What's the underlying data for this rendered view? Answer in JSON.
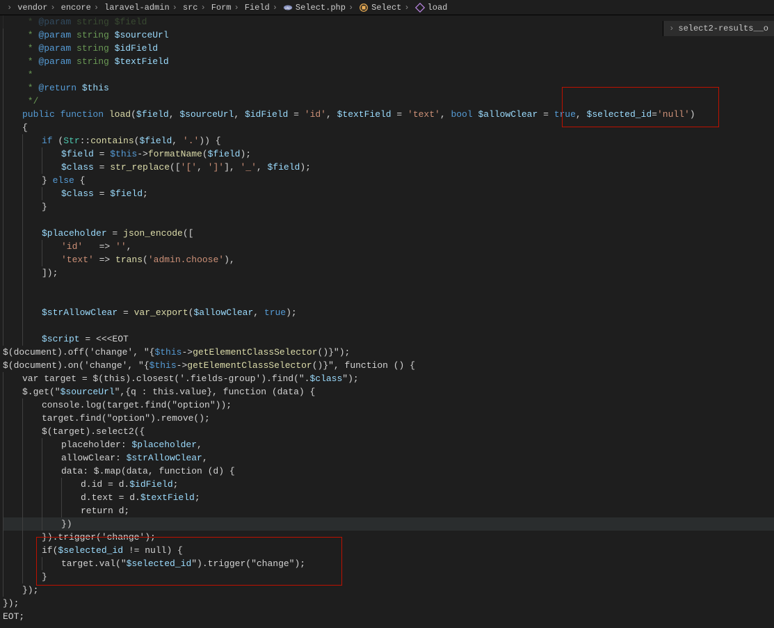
{
  "breadcrumb": {
    "items": [
      {
        "label": "vendor",
        "icon": null
      },
      {
        "label": "encore",
        "icon": null
      },
      {
        "label": "laravel-admin",
        "icon": null
      },
      {
        "label": "src",
        "icon": null
      },
      {
        "label": "Form",
        "icon": null
      },
      {
        "label": "Field",
        "icon": null
      },
      {
        "label": "Select.php",
        "icon": "php"
      },
      {
        "label": "Select",
        "icon": "class"
      },
      {
        "label": "load",
        "icon": "method"
      }
    ]
  },
  "tabs": {
    "right": {
      "label": "select2-results__o"
    }
  },
  "code_lines": [
    {
      "ind": 1,
      "tokens": [
        {
          "c": "c-comment",
          "t": " * "
        },
        {
          "c": "c-doctag",
          "t": "@param"
        },
        {
          "c": "c-comment",
          "t": " string $field"
        }
      ],
      "faded": true
    },
    {
      "ind": 1,
      "tokens": [
        {
          "c": "c-comment",
          "t": " * "
        },
        {
          "c": "c-doctag",
          "t": "@param"
        },
        {
          "c": "c-comment",
          "t": " string "
        },
        {
          "c": "c-var",
          "t": "$sourceUrl"
        }
      ]
    },
    {
      "ind": 1,
      "tokens": [
        {
          "c": "c-comment",
          "t": " * "
        },
        {
          "c": "c-doctag",
          "t": "@param"
        },
        {
          "c": "c-comment",
          "t": " string "
        },
        {
          "c": "c-var",
          "t": "$idField"
        }
      ]
    },
    {
      "ind": 1,
      "tokens": [
        {
          "c": "c-comment",
          "t": " * "
        },
        {
          "c": "c-doctag",
          "t": "@param"
        },
        {
          "c": "c-comment",
          "t": " string "
        },
        {
          "c": "c-var",
          "t": "$textField"
        }
      ]
    },
    {
      "ind": 1,
      "tokens": [
        {
          "c": "c-comment",
          "t": " *"
        }
      ]
    },
    {
      "ind": 1,
      "tokens": [
        {
          "c": "c-comment",
          "t": " * "
        },
        {
          "c": "c-doctag",
          "t": "@return"
        },
        {
          "c": "c-comment",
          "t": " "
        },
        {
          "c": "c-var",
          "t": "$this"
        }
      ]
    },
    {
      "ind": 1,
      "tokens": [
        {
          "c": "c-comment",
          "t": " */"
        }
      ]
    },
    {
      "ind": 1,
      "tokens": [
        {
          "c": "c-kw",
          "t": "public"
        },
        {
          "c": "c-op",
          "t": " "
        },
        {
          "c": "c-kw",
          "t": "function"
        },
        {
          "c": "c-op",
          "t": " "
        },
        {
          "c": "c-fn",
          "t": "load"
        },
        {
          "c": "c-punct",
          "t": "("
        },
        {
          "c": "c-var",
          "t": "$field"
        },
        {
          "c": "c-punct",
          "t": ", "
        },
        {
          "c": "c-var",
          "t": "$sourceUrl"
        },
        {
          "c": "c-punct",
          "t": ", "
        },
        {
          "c": "c-var",
          "t": "$idField"
        },
        {
          "c": "c-op",
          "t": " = "
        },
        {
          "c": "c-str",
          "t": "'id'"
        },
        {
          "c": "c-punct",
          "t": ", "
        },
        {
          "c": "c-var",
          "t": "$textField"
        },
        {
          "c": "c-op",
          "t": " = "
        },
        {
          "c": "c-str",
          "t": "'text'"
        },
        {
          "c": "c-punct",
          "t": ", "
        },
        {
          "c": "c-kw",
          "t": "bool"
        },
        {
          "c": "c-op",
          "t": " "
        },
        {
          "c": "c-var",
          "t": "$allowClear"
        },
        {
          "c": "c-op",
          "t": " = "
        },
        {
          "c": "c-const",
          "t": "true"
        },
        {
          "c": "c-punct",
          "t": ", "
        },
        {
          "c": "c-var",
          "t": "$selected_id"
        },
        {
          "c": "c-op",
          "t": "="
        },
        {
          "c": "c-str",
          "t": "'null'"
        },
        {
          "c": "c-punct",
          "t": ")"
        }
      ]
    },
    {
      "ind": 1,
      "tokens": [
        {
          "c": "c-punct",
          "t": "{"
        }
      ]
    },
    {
      "ind": 2,
      "tokens": [
        {
          "c": "c-kw",
          "t": "if"
        },
        {
          "c": "c-punct",
          "t": " ("
        },
        {
          "c": "c-type",
          "t": "Str"
        },
        {
          "c": "c-punct",
          "t": "::"
        },
        {
          "c": "c-fn",
          "t": "contains"
        },
        {
          "c": "c-punct",
          "t": "("
        },
        {
          "c": "c-var",
          "t": "$field"
        },
        {
          "c": "c-punct",
          "t": ", "
        },
        {
          "c": "c-str",
          "t": "'.'"
        },
        {
          "c": "c-punct",
          "t": ")) {"
        }
      ]
    },
    {
      "ind": 3,
      "tokens": [
        {
          "c": "c-var",
          "t": "$field"
        },
        {
          "c": "c-op",
          "t": " = "
        },
        {
          "c": "c-this",
          "t": "$this"
        },
        {
          "c": "c-punct",
          "t": "->"
        },
        {
          "c": "c-fn",
          "t": "formatName"
        },
        {
          "c": "c-punct",
          "t": "("
        },
        {
          "c": "c-var",
          "t": "$field"
        },
        {
          "c": "c-punct",
          "t": ");"
        }
      ]
    },
    {
      "ind": 3,
      "tokens": [
        {
          "c": "c-var",
          "t": "$class"
        },
        {
          "c": "c-op",
          "t": " = "
        },
        {
          "c": "c-fn",
          "t": "str_replace"
        },
        {
          "c": "c-punct",
          "t": "(["
        },
        {
          "c": "c-str",
          "t": "'['"
        },
        {
          "c": "c-punct",
          "t": ", "
        },
        {
          "c": "c-str",
          "t": "']'"
        },
        {
          "c": "c-punct",
          "t": "], "
        },
        {
          "c": "c-str",
          "t": "'_'"
        },
        {
          "c": "c-punct",
          "t": ", "
        },
        {
          "c": "c-var",
          "t": "$field"
        },
        {
          "c": "c-punct",
          "t": ");"
        }
      ]
    },
    {
      "ind": 2,
      "tokens": [
        {
          "c": "c-punct",
          "t": "} "
        },
        {
          "c": "c-kw",
          "t": "else"
        },
        {
          "c": "c-punct",
          "t": " {"
        }
      ]
    },
    {
      "ind": 3,
      "tokens": [
        {
          "c": "c-var",
          "t": "$class"
        },
        {
          "c": "c-op",
          "t": " = "
        },
        {
          "c": "c-var",
          "t": "$field"
        },
        {
          "c": "c-punct",
          "t": ";"
        }
      ]
    },
    {
      "ind": 2,
      "tokens": [
        {
          "c": "c-punct",
          "t": "}"
        }
      ]
    },
    {
      "ind": 2,
      "tokens": []
    },
    {
      "ind": 2,
      "tokens": [
        {
          "c": "c-var",
          "t": "$placeholder"
        },
        {
          "c": "c-op",
          "t": " = "
        },
        {
          "c": "c-fn",
          "t": "json_encode"
        },
        {
          "c": "c-punct",
          "t": "(["
        }
      ]
    },
    {
      "ind": 3,
      "tokens": [
        {
          "c": "c-str",
          "t": "'id'"
        },
        {
          "c": "c-op",
          "t": "   => "
        },
        {
          "c": "c-str",
          "t": "''"
        },
        {
          "c": "c-punct",
          "t": ","
        }
      ]
    },
    {
      "ind": 3,
      "tokens": [
        {
          "c": "c-str",
          "t": "'text'"
        },
        {
          "c": "c-op",
          "t": " => "
        },
        {
          "c": "c-fn",
          "t": "trans"
        },
        {
          "c": "c-punct",
          "t": "("
        },
        {
          "c": "c-str",
          "t": "'admin.choose'"
        },
        {
          "c": "c-punct",
          "t": "),"
        }
      ]
    },
    {
      "ind": 2,
      "tokens": [
        {
          "c": "c-punct",
          "t": "]);"
        }
      ]
    },
    {
      "ind": 2,
      "tokens": []
    },
    {
      "ind": 2,
      "tokens": []
    },
    {
      "ind": 2,
      "tokens": [
        {
          "c": "c-var",
          "t": "$strAllowClear"
        },
        {
          "c": "c-op",
          "t": " = "
        },
        {
          "c": "c-fn",
          "t": "var_export"
        },
        {
          "c": "c-punct",
          "t": "("
        },
        {
          "c": "c-var",
          "t": "$allowClear"
        },
        {
          "c": "c-punct",
          "t": ", "
        },
        {
          "c": "c-const",
          "t": "true"
        },
        {
          "c": "c-punct",
          "t": ");"
        }
      ]
    },
    {
      "ind": 2,
      "tokens": []
    },
    {
      "ind": 2,
      "tokens": [
        {
          "c": "c-var",
          "t": "$script"
        },
        {
          "c": "c-op",
          "t": " = <<<EOT"
        }
      ]
    },
    {
      "ind": 0,
      "tokens": [
        {
          "c": "c-op",
          "t": "$(document).off('change', \""
        },
        {
          "c": "c-punct",
          "t": "{"
        },
        {
          "c": "c-this",
          "t": "$this"
        },
        {
          "c": "c-punct",
          "t": "->"
        },
        {
          "c": "c-fn",
          "t": "getElementClassSelector"
        },
        {
          "c": "c-punct",
          "t": "()}"
        },
        {
          "c": "c-op",
          "t": "\");"
        }
      ]
    },
    {
      "ind": 0,
      "tokens": [
        {
          "c": "c-op",
          "t": "$(document).on('change', \""
        },
        {
          "c": "c-punct",
          "t": "{"
        },
        {
          "c": "c-this",
          "t": "$this"
        },
        {
          "c": "c-punct",
          "t": "->"
        },
        {
          "c": "c-fn",
          "t": "getElementClassSelector"
        },
        {
          "c": "c-punct",
          "t": "()}"
        },
        {
          "c": "c-op",
          "t": "\", function () {"
        }
      ]
    },
    {
      "ind": 1,
      "tokens": [
        {
          "c": "c-op",
          "t": "var target = $(this).closest('.fields-group').find(\"."
        },
        {
          "c": "c-var",
          "t": "$class"
        },
        {
          "c": "c-op",
          "t": "\");"
        }
      ]
    },
    {
      "ind": 1,
      "tokens": [
        {
          "c": "c-op",
          "t": "$.get(\""
        },
        {
          "c": "c-var",
          "t": "$sourceUrl"
        },
        {
          "c": "c-op",
          "t": "\",{q : this.value}, function (data) {"
        }
      ]
    },
    {
      "ind": 2,
      "tokens": [
        {
          "c": "c-op",
          "t": "console.log(target.find(\"option\"));"
        }
      ]
    },
    {
      "ind": 2,
      "tokens": [
        {
          "c": "c-op",
          "t": "target.find(\"option\").remove();"
        }
      ]
    },
    {
      "ind": 2,
      "tokens": [
        {
          "c": "c-op",
          "t": "$(target).select2({"
        }
      ]
    },
    {
      "ind": 3,
      "tokens": [
        {
          "c": "c-op",
          "t": "placeholder: "
        },
        {
          "c": "c-var",
          "t": "$placeholder"
        },
        {
          "c": "c-op",
          "t": ","
        }
      ]
    },
    {
      "ind": 3,
      "tokens": [
        {
          "c": "c-op",
          "t": "allowClear: "
        },
        {
          "c": "c-var",
          "t": "$strAllowClear"
        },
        {
          "c": "c-op",
          "t": ","
        }
      ]
    },
    {
      "ind": 3,
      "tokens": [
        {
          "c": "c-op",
          "t": "data: $.map(data, function (d) {"
        }
      ]
    },
    {
      "ind": 4,
      "tokens": [
        {
          "c": "c-op",
          "t": "d.id = d."
        },
        {
          "c": "c-var",
          "t": "$idField"
        },
        {
          "c": "c-op",
          "t": ";"
        }
      ]
    },
    {
      "ind": 4,
      "tokens": [
        {
          "c": "c-op",
          "t": "d.text = d."
        },
        {
          "c": "c-var",
          "t": "$textField"
        },
        {
          "c": "c-op",
          "t": ";"
        }
      ]
    },
    {
      "ind": 4,
      "tokens": [
        {
          "c": "c-op",
          "t": "return d;"
        }
      ]
    },
    {
      "ind": 3,
      "tokens": [
        {
          "c": "c-op",
          "t": "})"
        }
      ],
      "cur": true
    },
    {
      "ind": 2,
      "tokens": [
        {
          "c": "c-op",
          "t": "}).trigger('change');"
        }
      ]
    },
    {
      "ind": 2,
      "tokens": [
        {
          "c": "c-op",
          "t": "if("
        },
        {
          "c": "c-var",
          "t": "$selected_id"
        },
        {
          "c": "c-op",
          "t": " != null) {"
        }
      ]
    },
    {
      "ind": 3,
      "tokens": [
        {
          "c": "c-op",
          "t": "target.val(\""
        },
        {
          "c": "c-var",
          "t": "$selected_id"
        },
        {
          "c": "c-op",
          "t": "\").trigger(\"change\");"
        }
      ]
    },
    {
      "ind": 2,
      "tokens": [
        {
          "c": "c-op",
          "t": "}"
        }
      ]
    },
    {
      "ind": 1,
      "tokens": [
        {
          "c": "c-op",
          "t": "});"
        }
      ]
    },
    {
      "ind": 0,
      "tokens": [
        {
          "c": "c-op",
          "t": "});"
        }
      ]
    },
    {
      "ind": 0,
      "tokens": [
        {
          "c": "c-op",
          "t": "EOT;"
        }
      ]
    }
  ]
}
